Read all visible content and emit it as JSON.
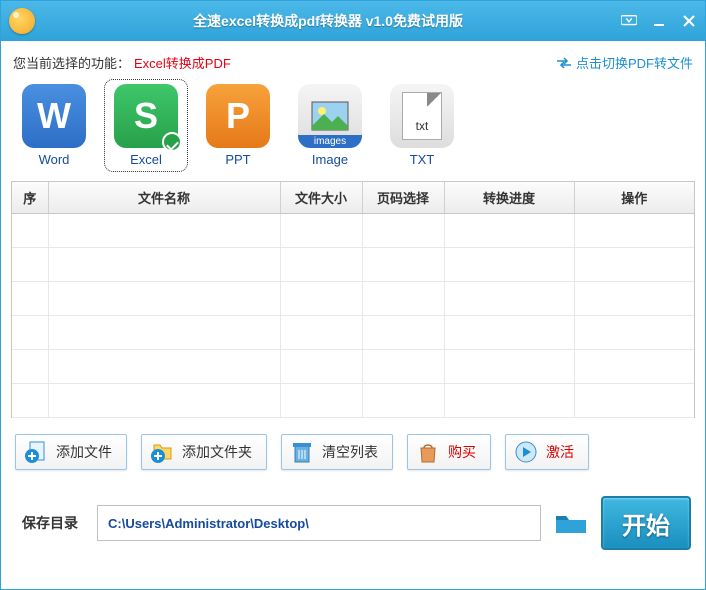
{
  "window": {
    "title": "全速excel转换成pdf转换器 v1.0免费试用版"
  },
  "func": {
    "label": "您当前选择的功能：",
    "name": "Excel转换成PDF",
    "switch": "点击切换PDF转文件"
  },
  "formats": [
    {
      "label": "Word"
    },
    {
      "label": "Excel"
    },
    {
      "label": "PPT"
    },
    {
      "label": "Image",
      "sub": "images"
    },
    {
      "label": "TXT",
      "sub": "txt"
    }
  ],
  "table": {
    "headers": [
      "序",
      "文件名称",
      "文件大小",
      "页码选择",
      "转换进度",
      "操作"
    ]
  },
  "actions": {
    "add_file": "添加文件",
    "add_folder": "添加文件夹",
    "clear": "清空列表",
    "buy": "购买",
    "activate": "激活"
  },
  "save": {
    "label": "保存目录",
    "path": "C:\\Users\\Administrator\\Desktop\\"
  },
  "start": "开始"
}
